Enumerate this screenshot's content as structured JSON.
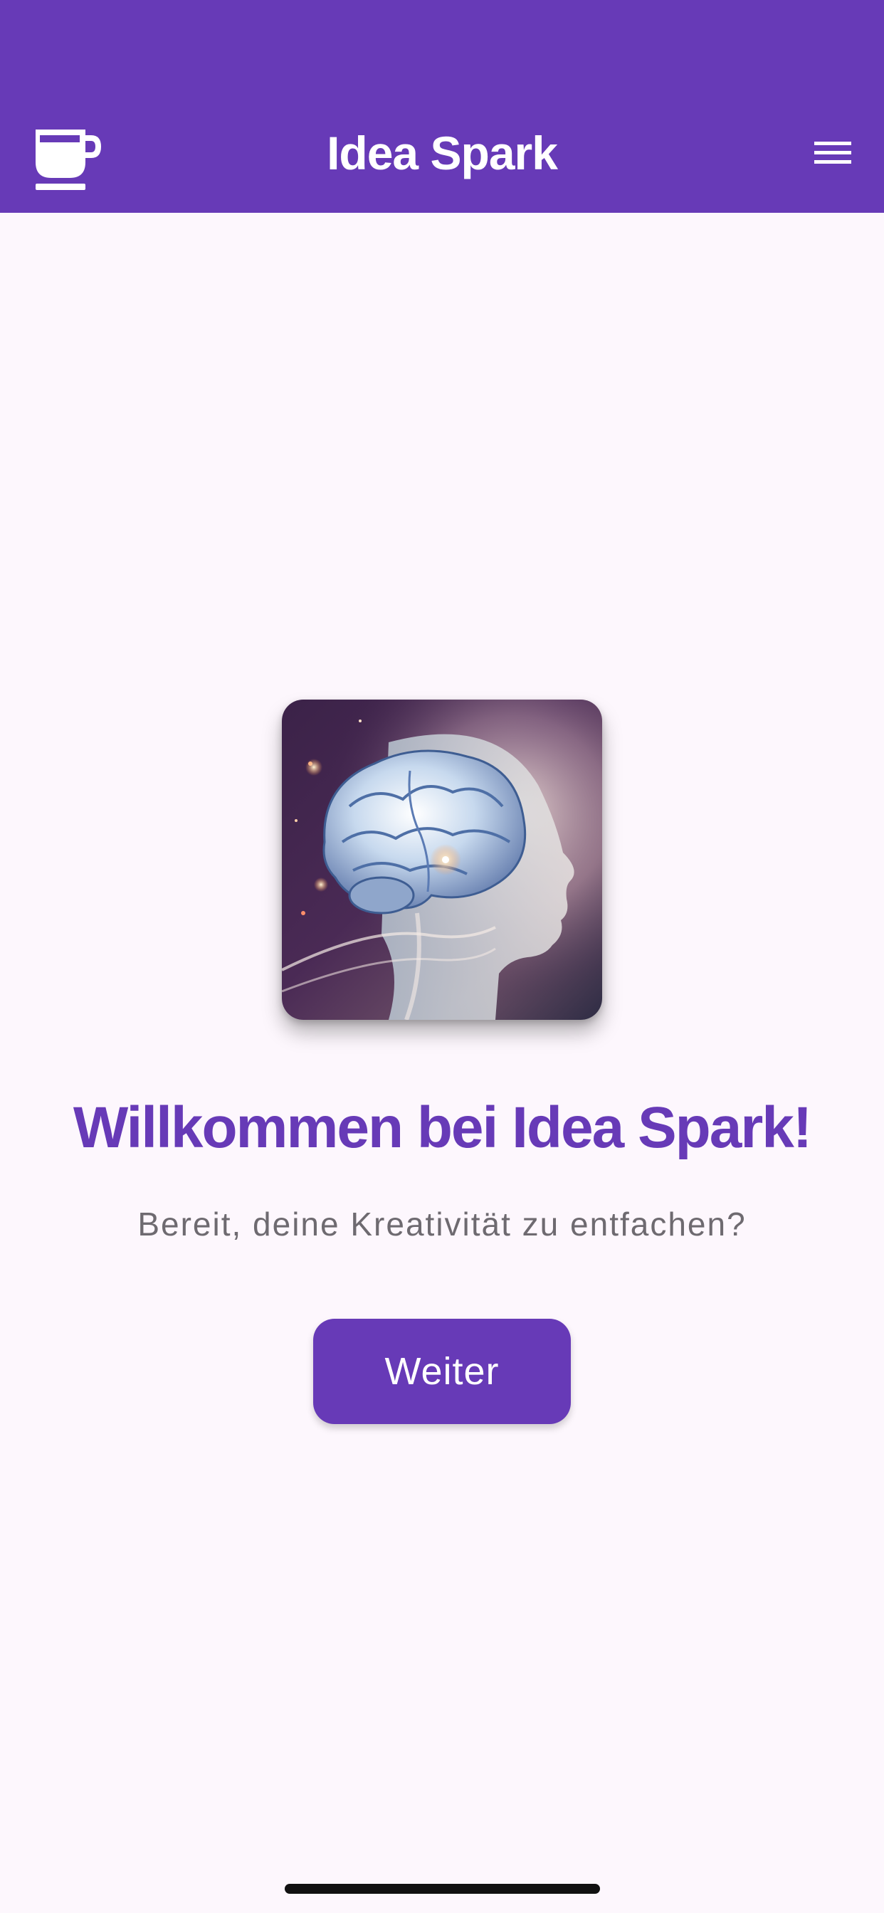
{
  "app_bar": {
    "title": "Idea Spark",
    "left_icon": "coffee-cup-icon",
    "right_icon": "menu-icon",
    "background_color": "#673AB7"
  },
  "main": {
    "hero_image": "brain-head-illustration",
    "heading": "Willkommen bei Idea Spark!",
    "subtitle": "Bereit, deine Kreativität zu entfachen?",
    "continue_label": "Weiter"
  },
  "colors": {
    "accent": "#673AB7",
    "background": "#FDF7FD",
    "subtitle_text": "#6E6A70"
  }
}
